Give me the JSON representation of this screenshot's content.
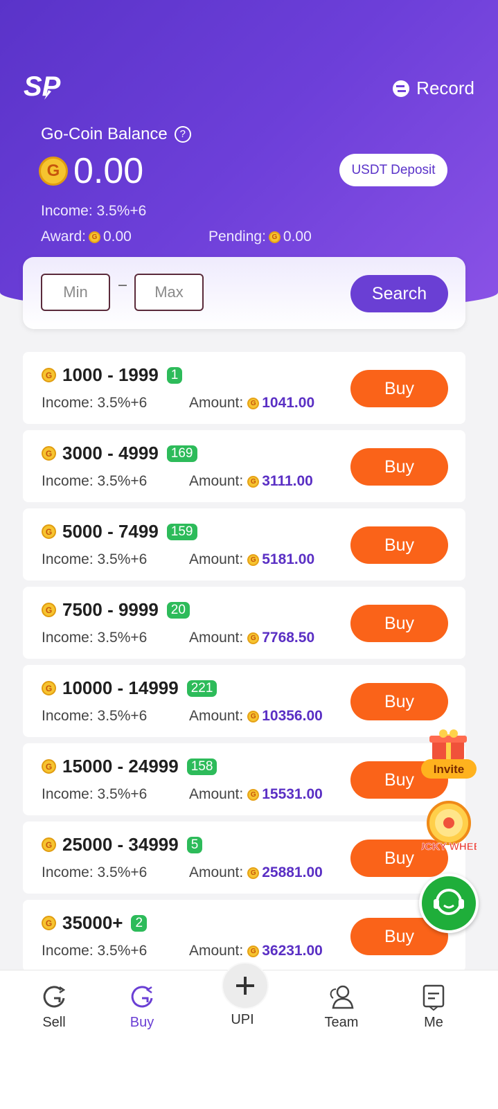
{
  "header": {
    "record_label": "Record",
    "balance_label": "Go-Coin Balance",
    "balance_value": "0.00",
    "deposit_button": "USDT Deposit",
    "income_text": "Income: 3.5%+6",
    "award_label": "Award:",
    "award_value": "0.00",
    "pending_label": "Pending:",
    "pending_value": "0.00"
  },
  "search": {
    "min_placeholder": "Min",
    "max_placeholder": "Max",
    "button_label": "Search"
  },
  "offers": [
    {
      "range": "1000 - 1999",
      "count": "1",
      "income": "Income: 3.5%+6",
      "amount_label": "Amount:",
      "amount": "1041.00",
      "buy": "Buy"
    },
    {
      "range": "3000 - 4999",
      "count": "169",
      "income": "Income: 3.5%+6",
      "amount_label": "Amount:",
      "amount": "3111.00",
      "buy": "Buy"
    },
    {
      "range": "5000 - 7499",
      "count": "159",
      "income": "Income: 3.5%+6",
      "amount_label": "Amount:",
      "amount": "5181.00",
      "buy": "Buy"
    },
    {
      "range": "7500 - 9999",
      "count": "20",
      "income": "Income: 3.5%+6",
      "amount_label": "Amount:",
      "amount": "7768.50",
      "buy": "Buy"
    },
    {
      "range": "10000 - 14999",
      "count": "221",
      "income": "Income: 3.5%+6",
      "amount_label": "Amount:",
      "amount": "10356.00",
      "buy": "Buy"
    },
    {
      "range": "15000 - 24999",
      "count": "158",
      "income": "Income: 3.5%+6",
      "amount_label": "Amount:",
      "amount": "15531.00",
      "buy": "Buy"
    },
    {
      "range": "25000 - 34999",
      "count": "5",
      "income": "Income: 3.5%+6",
      "amount_label": "Amount:",
      "amount": "25881.00",
      "buy": "Buy"
    },
    {
      "range": "35000+",
      "count": "2",
      "income": "Income: 3.5%+6",
      "amount_label": "Amount:",
      "amount": "36231.00",
      "buy": "Buy"
    }
  ],
  "floating": {
    "invite_label": "Invite",
    "wheel_label": "LUCKY WHEEL"
  },
  "nav": {
    "sell": "Sell",
    "buy": "Buy",
    "upi": "UPI",
    "team": "Team",
    "me": "Me"
  },
  "colors": {
    "brand_purple": "#6a3fd4",
    "buy_orange": "#fa6319",
    "badge_green": "#2dbb5a",
    "support_green": "#1fae3a"
  }
}
